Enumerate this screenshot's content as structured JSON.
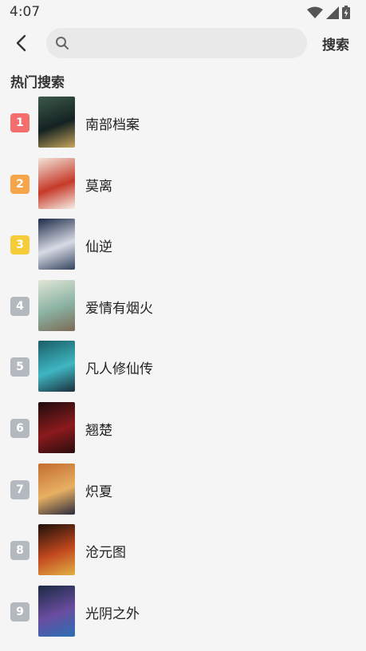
{
  "status_bar": {
    "time": "4:07"
  },
  "search": {
    "placeholder": "",
    "value": "",
    "submit_label": "搜索"
  },
  "hot_section": {
    "title": "热门搜索",
    "items": [
      {
        "rank": "1",
        "title": "南部档案",
        "badge_color": "#f46e6e",
        "poster_colors": [
          "#3c5a4a",
          "#142221",
          "#c7a65c"
        ]
      },
      {
        "rank": "2",
        "title": "莫离",
        "badge_color": "#f6a54a",
        "poster_colors": [
          "#f2e4d8",
          "#c63a2a",
          "#f6efe6"
        ]
      },
      {
        "rank": "3",
        "title": "仙逆",
        "badge_color": "#f6cc3a",
        "poster_colors": [
          "#1c2a49",
          "#d8dbe4",
          "#33425f"
        ]
      },
      {
        "rank": "4",
        "title": "爱情有烟火",
        "badge_color": "#b4b8bf",
        "poster_colors": [
          "#dfe6d6",
          "#8ab1a1",
          "#7b6a55"
        ]
      },
      {
        "rank": "5",
        "title": "凡人修仙传",
        "badge_color": "#b4b8bf",
        "poster_colors": [
          "#1a5d67",
          "#3fb6c1",
          "#1b2f3d"
        ]
      },
      {
        "rank": "6",
        "title": "翘楚",
        "badge_color": "#b4b8bf",
        "poster_colors": [
          "#1e0c0e",
          "#8b1a1c",
          "#2a0d0f"
        ]
      },
      {
        "rank": "7",
        "title": "炽夏",
        "badge_color": "#b4b8bf",
        "poster_colors": [
          "#c46d2e",
          "#e7b063",
          "#2a2b3c"
        ]
      },
      {
        "rank": "8",
        "title": "沧元图",
        "badge_color": "#b4b8bf",
        "poster_colors": [
          "#1c0f0a",
          "#c2481e",
          "#e2b045"
        ]
      },
      {
        "rank": "9",
        "title": "光阴之外",
        "badge_color": "#b4b8bf",
        "poster_colors": [
          "#1b2a44",
          "#6a4da0",
          "#2a6fb4"
        ]
      }
    ]
  }
}
